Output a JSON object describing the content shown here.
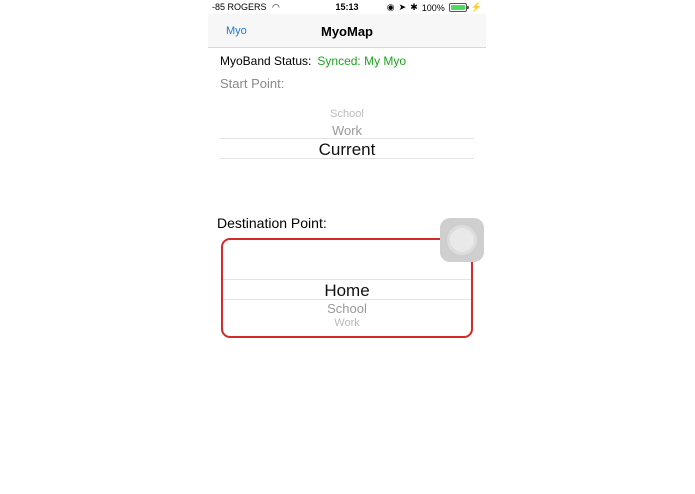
{
  "status_bar": {
    "carrier": "-85 ROGERS",
    "time": "15:13",
    "battery": "100%",
    "battery_level": 1.0
  },
  "nav": {
    "back_label": "Myo",
    "title": "MyoMap"
  },
  "myoband": {
    "label": "MyoBand Status:",
    "value": "Synced: My Myo"
  },
  "start_point": {
    "label": "Start Point:",
    "options": [
      "School",
      "Work",
      "Current"
    ],
    "selected": "Current"
  },
  "destination_point": {
    "label": "Destination Point:",
    "options": [
      "Home",
      "School",
      "Work"
    ],
    "selected": "Home"
  },
  "colors": {
    "accent": "#1e7ad6",
    "synced": "#1ea31e",
    "highlight_border": "#d42a2a"
  }
}
